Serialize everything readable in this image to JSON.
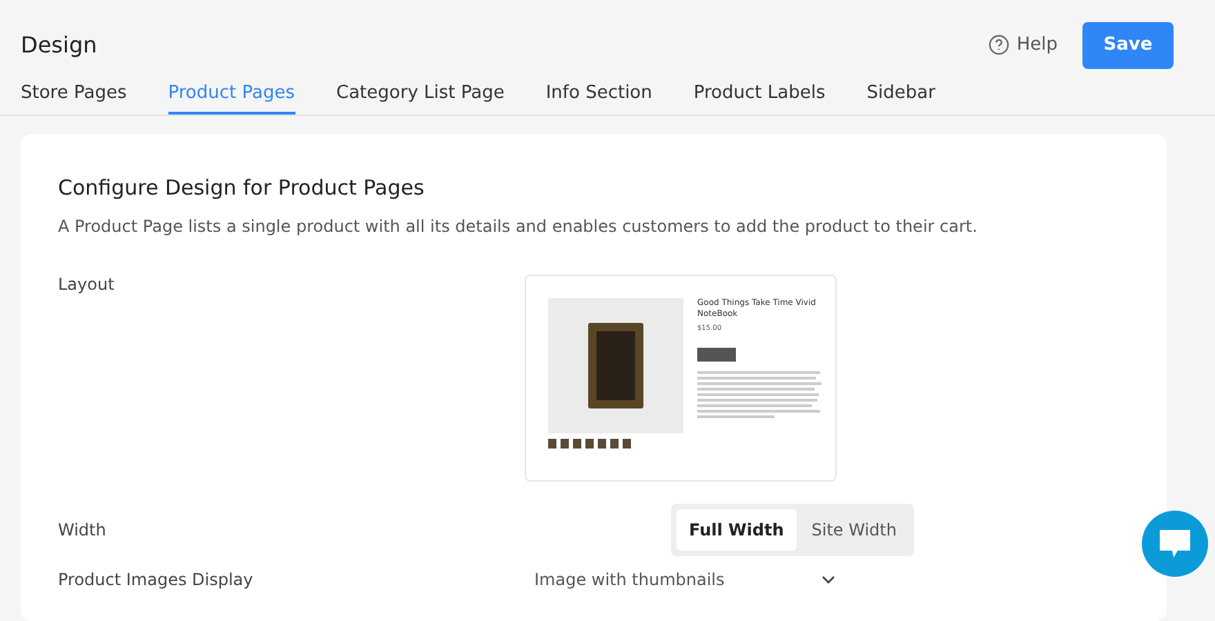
{
  "header": {
    "title": "Design",
    "help": "Help",
    "save": "Save"
  },
  "tabs": [
    {
      "label": "Store Pages",
      "selected": false
    },
    {
      "label": "Product Pages",
      "selected": true
    },
    {
      "label": "Category List Page",
      "selected": false
    },
    {
      "label": "Info Section",
      "selected": false
    },
    {
      "label": "Product Labels",
      "selected": false
    },
    {
      "label": "Sidebar",
      "selected": false
    }
  ],
  "section": {
    "title": "Configure Design for Product Pages",
    "description": "A Product Page lists a single product with all its details and enables customers to add the product to their cart."
  },
  "layout": {
    "label": "Layout",
    "preview": {
      "title": "Good Things Take Time Vivid NoteBook",
      "price": "$15.00"
    }
  },
  "width": {
    "label": "Width",
    "options": [
      {
        "label": "Full Width",
        "selected": true
      },
      {
        "label": "Site Width",
        "selected": false
      }
    ]
  },
  "images_display": {
    "label": "Product Images Display",
    "value": "Image with thumbnails"
  }
}
